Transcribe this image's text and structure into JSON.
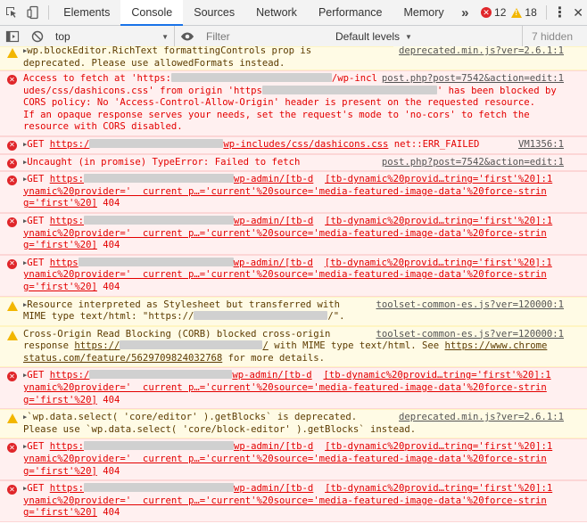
{
  "tabs": [
    "Elements",
    "Console",
    "Sources",
    "Network",
    "Performance",
    "Memory"
  ],
  "active_tab": "Console",
  "counters": {
    "errors": "12",
    "warnings": "18"
  },
  "toolbar": {
    "context": "top",
    "filter_placeholder": "Filter",
    "levels": "Default levels",
    "hidden": "7 hidden"
  },
  "messages": {
    "m0": {
      "l1": "wp.blockEditor.RichText formattingControls prop is",
      "l2": "deprecated. Please use allowedFormats instead.",
      "src": "deprecated.min.js?ver=2.6.1:1"
    },
    "m1": {
      "l1a": "Access to fetch at 'https:",
      "l1b": "/wp-incl",
      "l1c": "udes/css/dashicons.css' from origin 'https",
      "l1d": "' has been blocked by",
      "l2": "CORS policy: No 'Access-Control-Allow-Origin' header is present on the requested resource.",
      "l3": "If an opaque response serves your needs, set the request's mode to 'no-cors' to fetch the",
      "l4": "resource with CORS disabled.",
      "src": "post.php?post=7542&action=edit:1"
    },
    "m2": {
      "a": "GET ",
      "b": "https:/",
      "c": "wp-includes/css/dashicons.css",
      "d": "net::ERR_FAILED",
      "src": "VM1356:1"
    },
    "m3": {
      "t": "Uncaught (in promise) TypeError: Failed to fetch",
      "src": "post.php?post=7542&action=edit:1"
    },
    "m4": {
      "a": "GET ",
      "b": "https:",
      "c": "wp-admin/[tb-d",
      "d": "[tb-dynamic%20provid…tring='first'%20]:1",
      "l2": "ynamic%20provider='  current p…='current'%20source='media-featured-image-data'%20force-strin",
      "l3a": "g='first'%20]",
      "l3b": " 404"
    },
    "m5": {
      "a": "GET ",
      "b": "https:",
      "c": "wp-admin/[tb-d",
      "d": "[tb-dynamic%20provid…tring='first'%20]:1",
      "l2": "ynamic%20provider='  current p…='current'%20source='media-featured-image-data'%20force-strin",
      "l3a": "g='first'%20]",
      "l3b": " 404"
    },
    "m6": {
      "a": "GET ",
      "b": "https",
      "c": "wp-admin/[tb-d",
      "d": "[tb-dynamic%20provid…tring='first'%20]:1",
      "l2": "ynamic%20provider='  current p…='current'%20source='media-featured-image-data'%20force-strin",
      "l3a": "g='first'%20]",
      "l3b": " 404"
    },
    "m7": {
      "l1": "Resource interpreted as Stylesheet but transferred with",
      "l2a": "MIME type text/html: \"https://",
      "l2b": "/\".",
      "src": "toolset-common-es.js?ver=120000:1"
    },
    "m8": {
      "l1": "Cross-Origin Read Blocking (CORB) blocked cross-origin",
      "l2a": "response ",
      "l2b": "https://",
      "l2c": "/",
      "l2d": " with MIME type text/html. See ",
      "l2e": "https://www.chrome",
      "l3a": "status.com/feature/5629709824032768",
      "l3b": " for more details.",
      "src": "toolset-common-es.js?ver=120000:1"
    },
    "m9": {
      "a": "GET ",
      "b": "https:/",
      "c": "wp-admin/[tb-d",
      "d": "[tb-dynamic%20provid…tring='first'%20]:1",
      "l2": "ynamic%20provider='  current p…='current'%20source='media-featured-image-data'%20force-strin",
      "l3a": "g='first'%20]",
      "l3b": " 404"
    },
    "m10": {
      "l1": "`wp.data.select( 'core/editor' ).getBlocks` is deprecated.",
      "l2": "Please use `wp.data.select( 'core/block-editor' ).getBlocks` instead.",
      "src": "deprecated.min.js?ver=2.6.1:1"
    },
    "m11": {
      "a": "GET ",
      "b": "https:",
      "c": "wp-admin/[tb-d",
      "d": "[tb-dynamic%20provid…tring='first'%20]:1",
      "l2": "ynamic%20provider='  current p…='current'%20source='media-featured-image-data'%20force-strin",
      "l3a": "g='first'%20]",
      "l3b": " 404"
    },
    "m12": {
      "a": "GET ",
      "b": "https:",
      "c": "wp-admin/[tb-d",
      "d": "[tb-dynamic%20provid…tring='first'%20]:1",
      "l2": "ynamic%20provider='  current p…='current'%20source='media-featured-image-data'%20force-strin",
      "l3a": "g='first'%20]",
      "l3b": " 404"
    }
  }
}
